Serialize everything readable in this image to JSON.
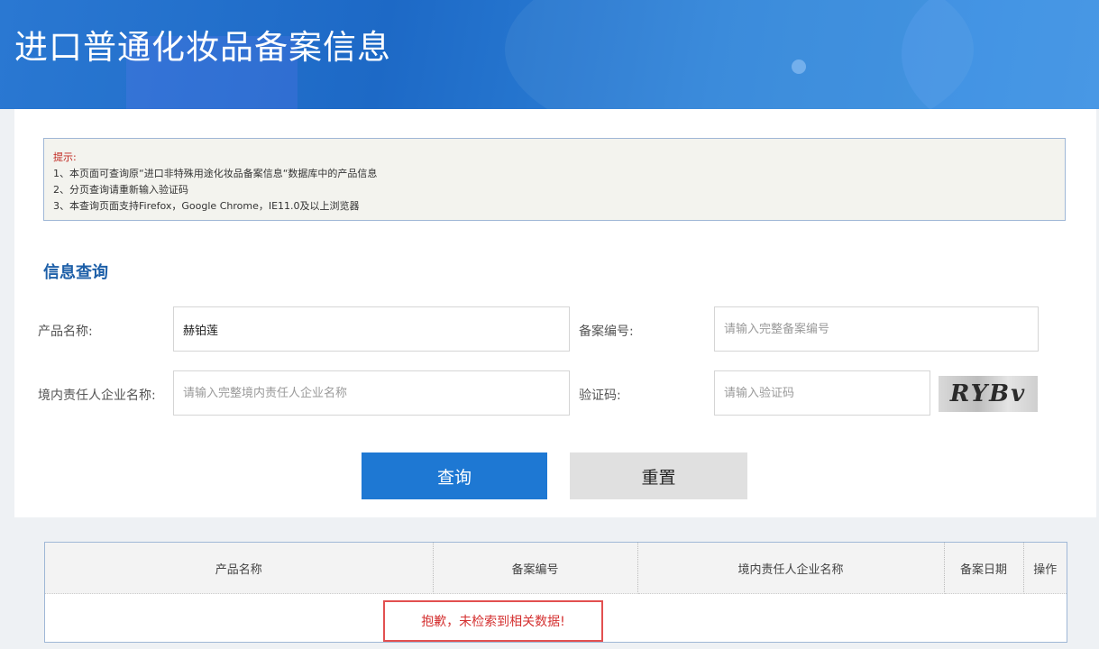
{
  "header": {
    "title": "进口普通化妆品备案信息"
  },
  "notice": {
    "title": "提示:",
    "lines": [
      "1、本页面可查询原“进口非特殊用途化妆品备案信息“数据库中的产品信息",
      "2、分页查询请重新输入验证码",
      "3、本查询页面支持Firefox，Google Chrome，IE11.0及以上浏览器"
    ]
  },
  "form": {
    "section_title": "信息查询",
    "product_name": {
      "label": "产品名称:",
      "value": "赫铂莲",
      "placeholder": ""
    },
    "record_no": {
      "label": "备案编号:",
      "value": "",
      "placeholder": "请输入完整备案编号"
    },
    "company": {
      "label": "境内责任人企业名称:",
      "value": "",
      "placeholder": "请输入完整境内责任人企业名称"
    },
    "captcha": {
      "label": "验证码:",
      "value": "",
      "placeholder": "请输入验证码",
      "image_text": "RYBv"
    },
    "query_button": "查询",
    "reset_button": "重置"
  },
  "results": {
    "columns": [
      "产品名称",
      "备案编号",
      "境内责任人企业名称",
      "备案日期",
      "操作"
    ],
    "empty_message": "抱歉，未检索到相关数据!"
  },
  "colors": {
    "header": "#2474cf",
    "accent": "#1e78d3",
    "warning": "#d43030"
  }
}
